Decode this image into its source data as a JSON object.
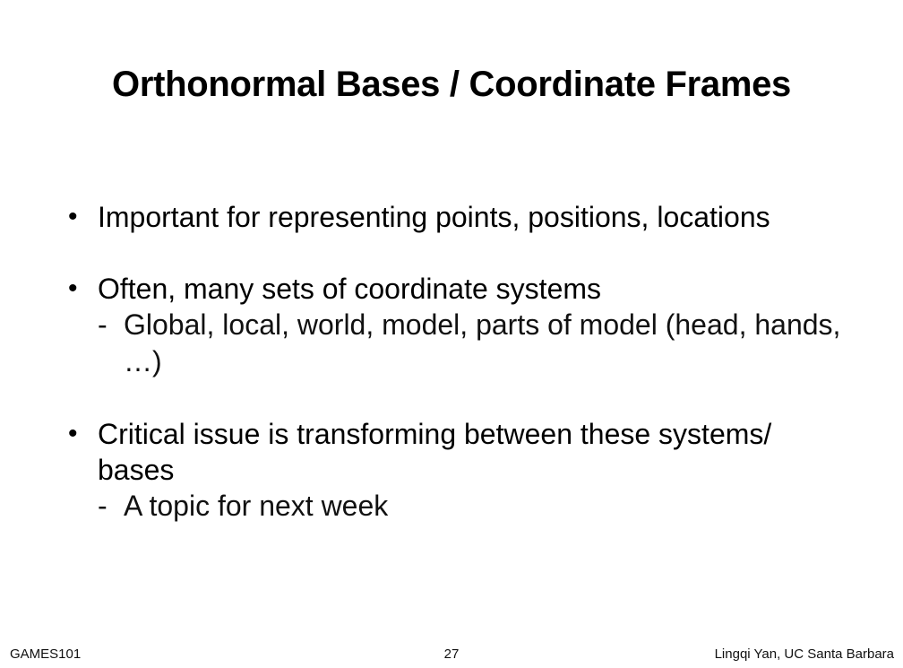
{
  "slide": {
    "title": "Orthonormal Bases / Coordinate Frames",
    "bullet_symbol": "•",
    "dash_symbol": "-",
    "bullets": [
      {
        "text": "Important for representing points, positions, locations",
        "subitems": []
      },
      {
        "text": "Often, many sets of coordinate systems",
        "subitems": [
          "Global, local, world, model, parts of model (head, hands, …)"
        ]
      },
      {
        "text": "Critical issue is transforming between these systems/ bases",
        "subitems": [
          "A topic for next week"
        ]
      }
    ]
  },
  "footer": {
    "course": "GAMES101",
    "page_number": "27",
    "author": "Lingqi Yan, UC Santa Barbara"
  }
}
